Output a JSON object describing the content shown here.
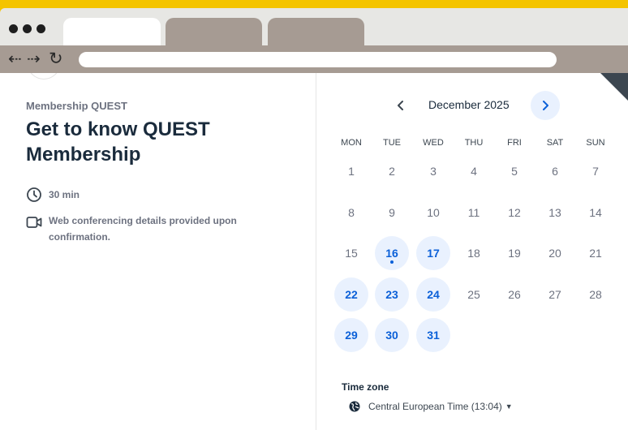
{
  "browser": {
    "nav": {
      "back": "⇠",
      "forward": "⇢",
      "reload": "↻"
    }
  },
  "event": {
    "organizer": "Membership QUEST",
    "title": "Get to know QUEST Membership",
    "duration": "30 min",
    "conferencing": "Web conferencing details provided upon confirmation."
  },
  "calendar": {
    "month_label": "December 2025",
    "weekdays": [
      "MON",
      "TUE",
      "WED",
      "THU",
      "FRI",
      "SAT",
      "SUN"
    ],
    "days": [
      {
        "n": "1"
      },
      {
        "n": "2"
      },
      {
        "n": "3"
      },
      {
        "n": "4"
      },
      {
        "n": "5"
      },
      {
        "n": "6"
      },
      {
        "n": "7"
      },
      {
        "n": "8"
      },
      {
        "n": "9"
      },
      {
        "n": "10"
      },
      {
        "n": "11"
      },
      {
        "n": "12"
      },
      {
        "n": "13"
      },
      {
        "n": "14"
      },
      {
        "n": "15"
      },
      {
        "n": "16",
        "available": true,
        "today": true
      },
      {
        "n": "17",
        "available": true
      },
      {
        "n": "18"
      },
      {
        "n": "19"
      },
      {
        "n": "20"
      },
      {
        "n": "21"
      },
      {
        "n": "22",
        "available": true
      },
      {
        "n": "23",
        "available": true
      },
      {
        "n": "24",
        "available": true
      },
      {
        "n": "25"
      },
      {
        "n": "26"
      },
      {
        "n": "27"
      },
      {
        "n": "28"
      },
      {
        "n": "29",
        "available": true
      },
      {
        "n": "30",
        "available": true
      },
      {
        "n": "31",
        "available": true
      }
    ]
  },
  "timezone": {
    "label": "Time zone",
    "value": "Central European Time (13:04)"
  },
  "colors": {
    "accent": "#0b60d8",
    "available_bg": "#e9f1fe",
    "frame": "#a69b93",
    "backdrop": "#f4c400"
  }
}
